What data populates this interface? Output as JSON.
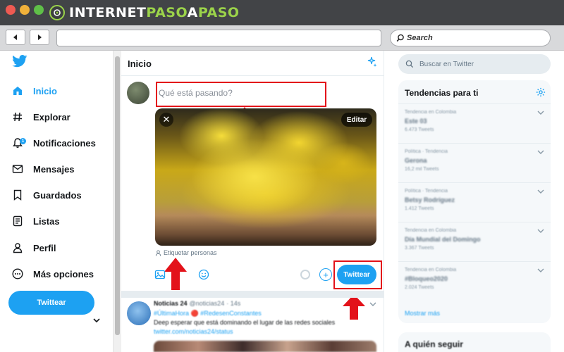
{
  "browser": {
    "brand_part1": "INTERNET",
    "brand_part2": "PASO",
    "brand_part3": "A",
    "brand_part4": "PASO",
    "search_placeholder": "Search",
    "traffic_colors": [
      "#ee5a52",
      "#f0b13a",
      "#5fbf48"
    ]
  },
  "sidebar": {
    "items": [
      {
        "label": "Inicio",
        "icon": "home-icon",
        "active": true
      },
      {
        "label": "Explorar",
        "icon": "hashtag-icon"
      },
      {
        "label": "Notificaciones",
        "icon": "bell-icon",
        "badge": "1"
      },
      {
        "label": "Mensajes",
        "icon": "envelope-icon"
      },
      {
        "label": "Guardados",
        "icon": "bookmark-icon"
      },
      {
        "label": "Listas",
        "icon": "list-icon"
      },
      {
        "label": "Perfil",
        "icon": "person-icon"
      },
      {
        "label": "Más opciones",
        "icon": "more-icon"
      }
    ],
    "tweet_button": "Twittear"
  },
  "feed": {
    "title": "Inicio",
    "compose_placeholder": "Qué está pasando?",
    "media_edit": "Editar",
    "media_close": "✕",
    "tag_people": "Etiquetar personas",
    "tweet_button": "Twittear",
    "plus": "+",
    "tweet2": {
      "name": "Noticias 24",
      "handle": "@noticias24",
      "time": "· 14s",
      "line1": "#ÚltimaHora 🔴 #RedesenConstantes",
      "line2": "Deep esperar que está dominando el lugar de las redes sociales",
      "line3": "twitter.com/noticias24/status"
    }
  },
  "right": {
    "search_placeholder": "Buscar en Twitter",
    "trends_title": "Tendencias para ti",
    "trends": [
      {
        "context": "Tendencia en Colombia",
        "name": "Este 03",
        "count": "6.473 Tweets"
      },
      {
        "context": "Política · Tendencia",
        "name": "Gerona",
        "count": "16,2 mil Tweets"
      },
      {
        "context": "Política · Tendencia",
        "name": "Betsy Rodríguez",
        "count": "1.412 Tweets"
      },
      {
        "context": "Tendencia en Colombia",
        "name": "Día Mundial del Domingo",
        "count": "3.367 Tweets"
      },
      {
        "context": "Tendencia en Colombia",
        "name": "#Bloqueo2020",
        "count": "2.024 Tweets"
      }
    ],
    "show_more": "Mostrar más",
    "who_to_follow": "A quién seguir"
  },
  "colors": {
    "accent": "#1da1f2",
    "highlight_red": "#e3121a",
    "brand_green": "#9bd34a"
  }
}
